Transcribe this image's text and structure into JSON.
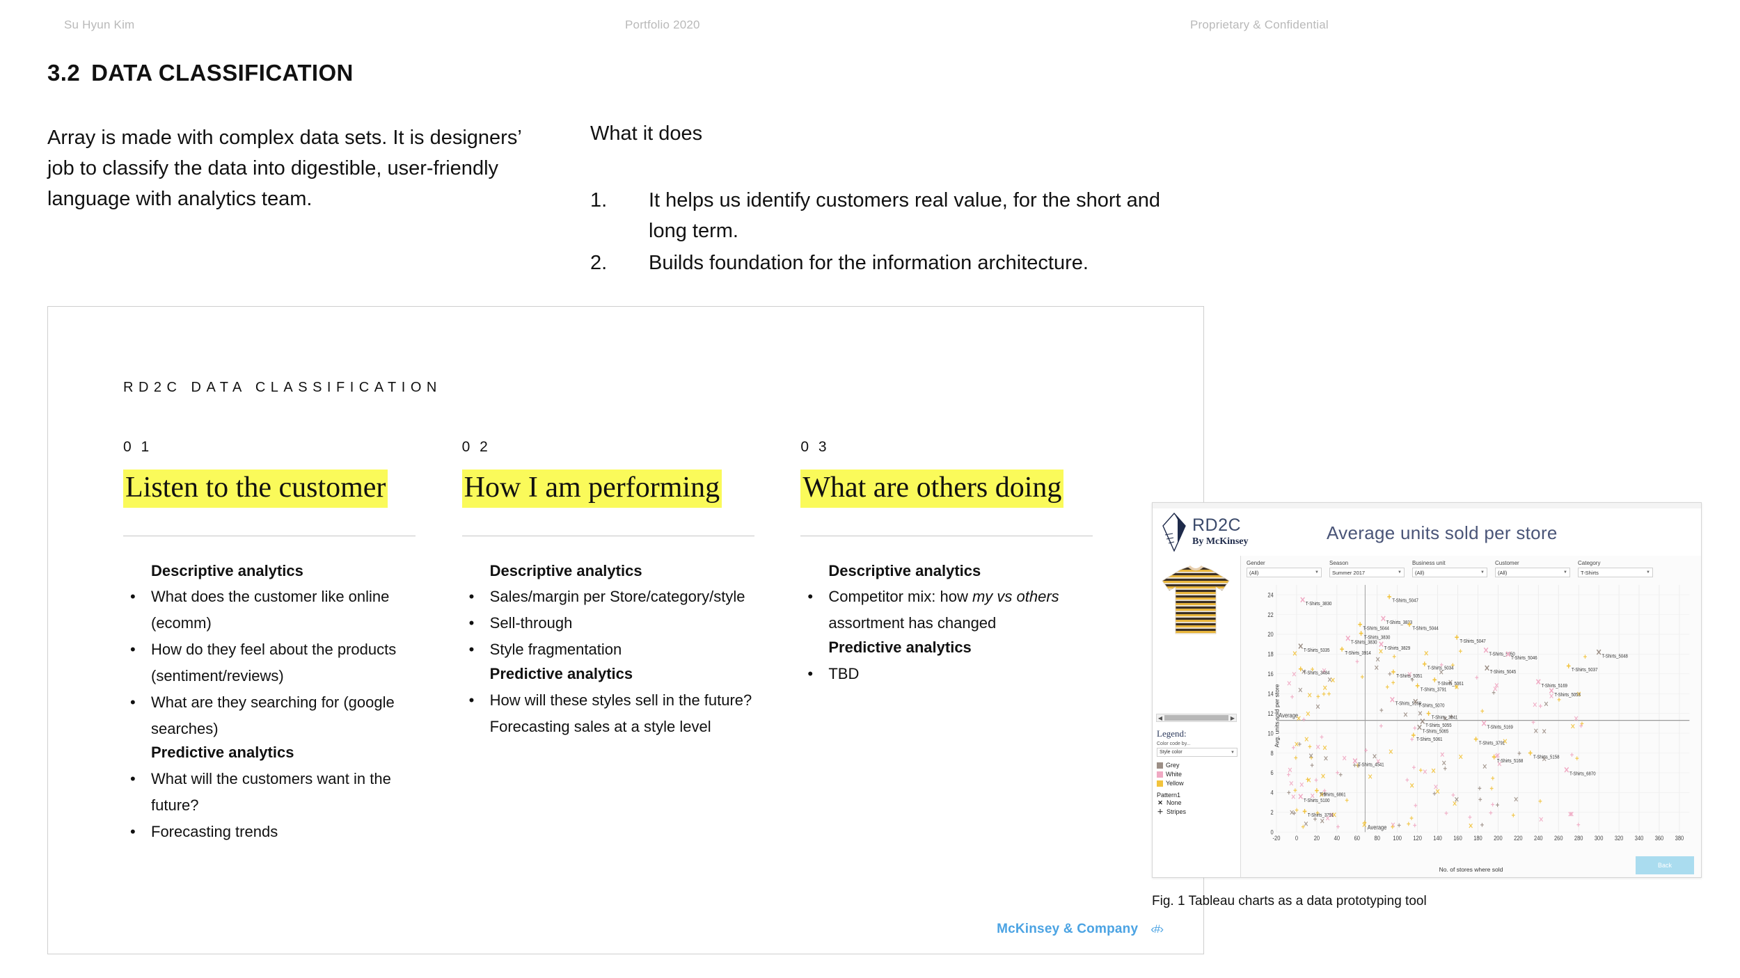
{
  "page_header": {
    "left": "Su Hyun Kim",
    "center": "Portfolio 2020",
    "right": "Proprietary & Confidential"
  },
  "section": {
    "number": "3.2",
    "title": "DATA CLASSIFICATION"
  },
  "intro": {
    "paragraph": "Array is made with complex data sets. It is designers’ job to classify the data into digestible, user-friendly language with analytics team."
  },
  "what_it_does": {
    "title": "What it does",
    "items": [
      {
        "number": "1.",
        "text": "It helps us identify customers real value, for the short and long term."
      },
      {
        "number": "2.",
        "text": "Builds foundation for the information architecture."
      }
    ]
  },
  "slide": {
    "kicker": "RD2C DATA CLASSIFICATION",
    "columns": [
      {
        "number": "0 1",
        "heading": "Listen to the customer",
        "groups": [
          {
            "title": "Descriptive analytics",
            "bullets": [
              {
                "bullet": "•",
                "text": "What does the customer like online (ecomm)"
              },
              {
                "bullet": "•",
                "text": "How do they feel about the products (sentiment/reviews)"
              },
              {
                "bullet": "•",
                "text": "What are they searching for (google searches)"
              }
            ]
          },
          {
            "title": "Predictive analytics",
            "bullets": [
              {
                "bullet": "•",
                "text": "What will the customers want in the future?"
              },
              {
                "bullet": "•",
                "text": "Forecasting trends"
              }
            ]
          }
        ]
      },
      {
        "number": "0 2",
        "heading": "How I am performing",
        "groups": [
          {
            "title": "Descriptive analytics",
            "bullets": [
              {
                "bullet": "•",
                "text": "Sales/margin per Store/category/style"
              },
              {
                "bullet": "•",
                "text": "Sell-through"
              },
              {
                "bullet": "•",
                "text": "Style fragmentation"
              }
            ]
          },
          {
            "title": "Predictive analytics",
            "bullets": [
              {
                "bullet": "•",
                "text": "How will these styles sell in the future? Forecasting sales at a style level"
              }
            ]
          }
        ]
      },
      {
        "number": "0 3",
        "heading": "What are others doing",
        "groups": [
          {
            "title": "Descriptive analytics",
            "bullets": [
              {
                "bullet": "•",
                "text_before": "Competitor mix: how ",
                "italic": "my vs others",
                "text_after": " assortment has changed"
              }
            ]
          },
          {
            "title": "Predictive analytics",
            "bullets": [
              {
                "bullet": "•",
                "text": "TBD"
              }
            ]
          }
        ]
      }
    ],
    "footer": {
      "brand": "McKinsey & Company",
      "mark": "‹#›"
    }
  },
  "tableau": {
    "logo": {
      "line1": "RD2C",
      "line2": "By McKinsey"
    },
    "title": "Average units sold per store",
    "filters": [
      {
        "label": "Gender",
        "value": "(All)"
      },
      {
        "label": "Season",
        "value": "Summer 2017"
      },
      {
        "label": "Business unit",
        "value": "(All)"
      },
      {
        "label": "Customer",
        "value": "(All)"
      },
      {
        "label": "Category",
        "value": "T-Shirts"
      }
    ],
    "legend": {
      "heading": "Legend:",
      "subtitle": "Color code by...",
      "select_value": "Style color",
      "colors": [
        {
          "name": "Grey",
          "hex": "#9c8f86"
        },
        {
          "name": "White",
          "hex": "#f0a9c3"
        },
        {
          "name": "Yellow",
          "hex": "#f2c33c"
        }
      ],
      "pattern_title": "Pattern1",
      "patterns": [
        {
          "symbol": "✕",
          "name": "None"
        },
        {
          "symbol": "＋",
          "name": "Stripes"
        }
      ]
    },
    "back_button": "Back",
    "chart_data": {
      "type": "scatter",
      "title": "Average units sold per store",
      "xlabel": "No. of stores where sold",
      "ylabel": "Avg. units sold per store",
      "xlim": [
        -20,
        390
      ],
      "ylim": [
        0,
        25
      ],
      "xticks": [
        -20,
        0,
        20,
        40,
        60,
        80,
        100,
        120,
        140,
        160,
        180,
        200,
        220,
        240,
        260,
        280,
        300,
        320,
        340,
        360,
        380
      ],
      "yticks": [
        0,
        2,
        4,
        6,
        8,
        10,
        12,
        14,
        16,
        18,
        20,
        22,
        24
      ],
      "grid": true,
      "reference_lines": [
        {
          "axis": "y",
          "value": 11.3,
          "label": "Average"
        },
        {
          "axis": "x",
          "value": 68,
          "label": "Average"
        }
      ],
      "series": [
        {
          "name": "Grey",
          "color": "#9c8f86"
        },
        {
          "name": "White",
          "color": "#f0a9c3"
        },
        {
          "name": "Yellow",
          "color": "#f2c33c"
        }
      ],
      "points": [
        {
          "x": 6,
          "y": 23.5,
          "color": "#f0a9c3",
          "marker": "x",
          "label": "T-Shirts_3830"
        },
        {
          "x": 92,
          "y": 23.8,
          "color": "#f2c33c",
          "marker": "+",
          "label": "T-Shirts_5047"
        },
        {
          "x": 86,
          "y": 21.6,
          "color": "#f0a9c3",
          "marker": "x",
          "label": "T-Shirts_3833"
        },
        {
          "x": 63,
          "y": 21.0,
          "color": "#f2c33c",
          "marker": "+",
          "label": "T-Shirts_5044"
        },
        {
          "x": 112,
          "y": 21.0,
          "color": "#f2c33c",
          "marker": "+",
          "label": "T-Shirts_5044"
        },
        {
          "x": 51,
          "y": 19.6,
          "color": "#f0a9c3",
          "marker": "x",
          "label": "T-Shirts_3830"
        },
        {
          "x": 64,
          "y": 20.1,
          "color": "#f2c33c",
          "marker": "+",
          "label": "T-Shirts_3830"
        },
        {
          "x": 4,
          "y": 18.8,
          "color": "#9c8f86",
          "marker": "x",
          "label": "T-Shirts_5335"
        },
        {
          "x": 45,
          "y": 18.5,
          "color": "#f2c33c",
          "marker": "+",
          "label": "T-Shirts_3914"
        },
        {
          "x": 4,
          "y": 16.5,
          "color": "#f2c33c",
          "marker": "+",
          "label": "T-Shirts_3484"
        },
        {
          "x": 84,
          "y": 19.0,
          "color": "#f0a9c3",
          "marker": "x",
          "label": "T-Shirts_3829"
        },
        {
          "x": 159,
          "y": 19.7,
          "color": "#f2c33c",
          "marker": "+",
          "label": "T-Shirts_5047"
        },
        {
          "x": 188,
          "y": 18.4,
          "color": "#f0a9c3",
          "marker": "x",
          "label": "T-Shirts_5050"
        },
        {
          "x": 210,
          "y": 18.0,
          "color": "#f0a9c3",
          "marker": "x",
          "label": "T-Shirts_5046"
        },
        {
          "x": 300,
          "y": 18.2,
          "color": "#9c8f86",
          "marker": "x",
          "label": "T-Shirts_5048"
        },
        {
          "x": 127,
          "y": 17.0,
          "color": "#f2c33c",
          "marker": "+",
          "label": "T-Shirts_5034"
        },
        {
          "x": 189,
          "y": 16.6,
          "color": "#9c8f86",
          "marker": "x",
          "label": "T-Shirts_5045"
        },
        {
          "x": 270,
          "y": 16.8,
          "color": "#f2c33c",
          "marker": "+",
          "label": "T-Shirts_5037"
        },
        {
          "x": 96,
          "y": 16.2,
          "color": "#f2c33c",
          "marker": "+",
          "label": "T-Shirts_5051"
        },
        {
          "x": 137,
          "y": 15.4,
          "color": "#f2c33c",
          "marker": "+",
          "label": "T-Shirts_5061"
        },
        {
          "x": 120,
          "y": 14.8,
          "color": "#f2c33c",
          "marker": "+",
          "label": "T-Shirts_3791"
        },
        {
          "x": 240,
          "y": 15.2,
          "color": "#f0a9c3",
          "marker": "x",
          "label": "T-Shirts_5169"
        },
        {
          "x": 253,
          "y": 14.3,
          "color": "#f0a9c3",
          "marker": "x",
          "label": "T-Shirts_5053"
        },
        {
          "x": 95,
          "y": 13.4,
          "color": "#f0a9c3",
          "marker": "x",
          "label": "T-Shirts_5169"
        },
        {
          "x": 118,
          "y": 13.2,
          "color": "#9c8f86",
          "marker": "x",
          "label": "T-Shirts_5070"
        },
        {
          "x": 131,
          "y": 12.0,
          "color": "#f2c33c",
          "marker": "+",
          "label": "T-Shirts_3841"
        },
        {
          "x": 125,
          "y": 11.2,
          "color": "#9c8f86",
          "marker": "x",
          "label": "T-Shirts_5055"
        },
        {
          "x": 122,
          "y": 10.6,
          "color": "#9c8f86",
          "marker": "x",
          "label": "T-Shirts_5065"
        },
        {
          "x": 116,
          "y": 9.8,
          "color": "#f2c33c",
          "marker": "+",
          "label": "T-Shirts_5061"
        },
        {
          "x": 186,
          "y": 11.0,
          "color": "#f0a9c3",
          "marker": "x",
          "label": "T-Shirts_5169"
        },
        {
          "x": 178,
          "y": 9.4,
          "color": "#f2c33c",
          "marker": "+",
          "label": "T-Shirts_3791"
        },
        {
          "x": 58,
          "y": 7.2,
          "color": "#f0a9c3",
          "marker": "x",
          "label": "T-Shirts_4541"
        },
        {
          "x": 20,
          "y": 4.2,
          "color": "#f2c33c",
          "marker": "+",
          "label": "T-Shirts_6861"
        },
        {
          "x": 4,
          "y": 3.6,
          "color": "#f0a9c3",
          "marker": "x",
          "label": "T-Shirts_5100"
        },
        {
          "x": 8,
          "y": 2.1,
          "color": "#f2c33c",
          "marker": "+",
          "label": "T-Shirts_3791"
        },
        {
          "x": 268,
          "y": 6.3,
          "color": "#f0a9c3",
          "marker": "x",
          "label": "T-Shirts_6870"
        },
        {
          "x": 196,
          "y": 7.6,
          "color": "#f2c33c",
          "marker": "+",
          "label": "T-Shirts_5168"
        },
        {
          "x": 232,
          "y": 8.0,
          "color": "#f2c33c",
          "marker": "+",
          "label": "T-Shirts_5158"
        }
      ]
    }
  },
  "figure_caption": "Fig. 1 Tableau charts as a data prototyping tool"
}
